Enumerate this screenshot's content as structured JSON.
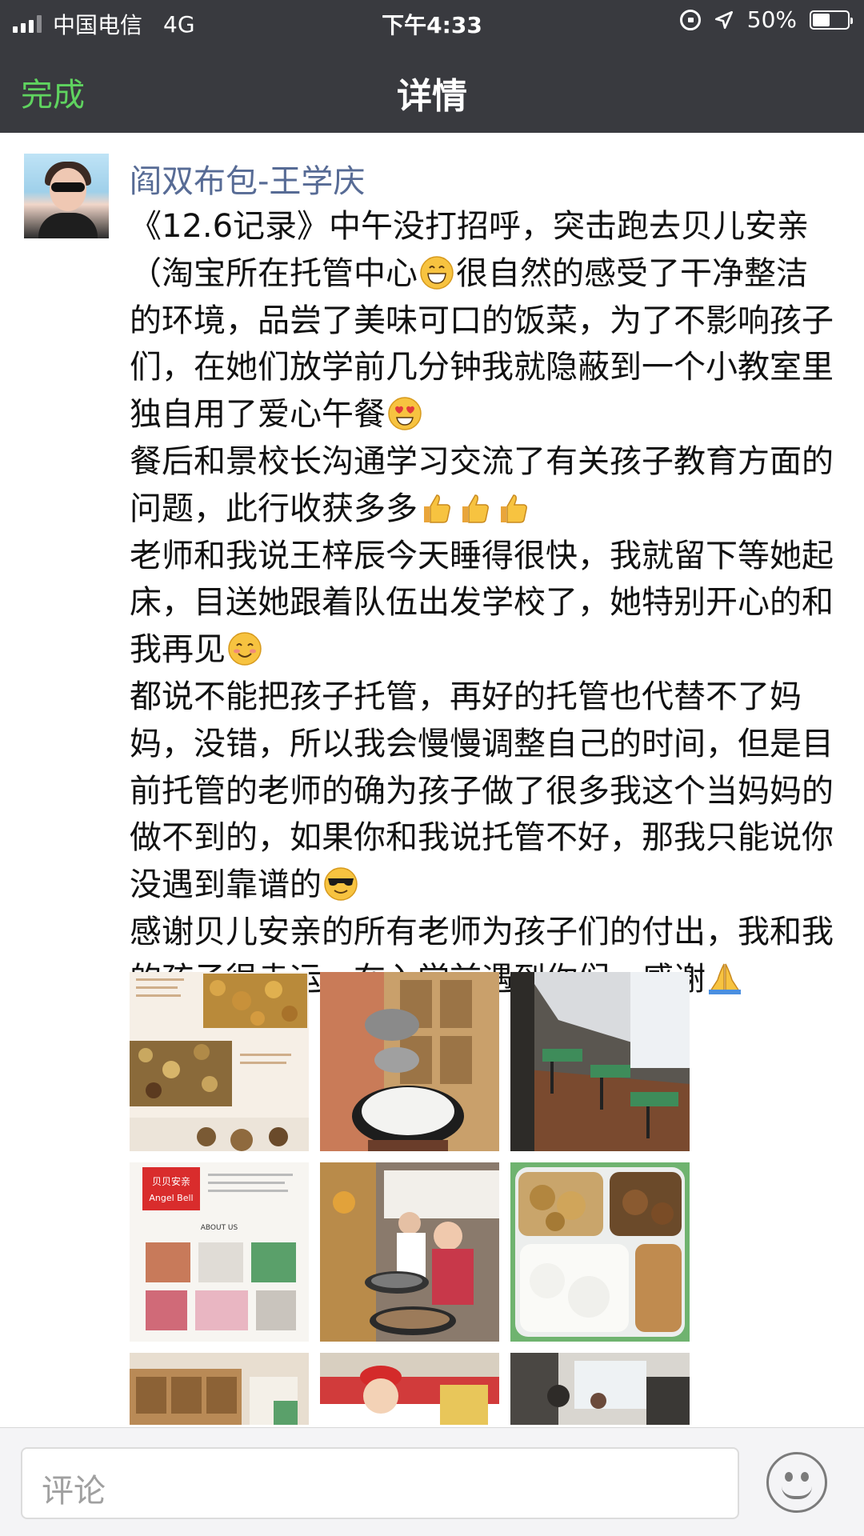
{
  "status_bar": {
    "carrier": "中国电信",
    "network": "4G",
    "time": "下午4:33",
    "battery": "50%",
    "battery_level": 0.5,
    "icons": [
      "signal-icon",
      "rotation-lock-icon",
      "location-arrow-icon",
      "battery-icon"
    ]
  },
  "navbar": {
    "done_label": "完成",
    "title": "详情",
    "accent_color": "#5fd35f"
  },
  "post": {
    "author": "阎双布包-王学庆",
    "paragraphs": [
      {
        "text": "《12.6记录》中午没打招呼，突击跑去贝儿安亲（淘宝所在托管中心",
        "emoji": "grinning-face-emoji",
        "text2": "很自然的感受了干净整洁的环境，品尝了美味可口的饭菜，为了不影响孩子们，在她们放学前几分钟我就隐蔽到一个小教室里独自用了爱心午餐",
        "emoji2": "heart-eyes-emoji"
      },
      {
        "text": "餐后和景校长沟通学习交流了有关孩子教育方面的问题，此行收获多多",
        "emoji": "thumbs-up-emoji-x3"
      },
      {
        "text": "老师和我说王梓辰今天睡得很快，我就留下等她起床，目送她跟着队伍出发学校了，她特别开心的和我再见",
        "emoji": "smiling-face-emoji"
      },
      {
        "text": "都说不能把孩子托管，再好的托管也代替不了妈妈，没错，所以我会慢慢调整自己的时间，但是目前托管的老师的确为孩子做了很多我这个当妈妈的做不到的，如果你和我说托管不好，那我只能说你没遇到靠谱的",
        "emoji": "sunglasses-emoji"
      },
      {
        "text": "感谢贝儿安亲的所有老师为孩子们的付出，我和我的孩子很幸运，在入学前遇到你们，感谢",
        "emoji": "folded-hands-emoji"
      }
    ],
    "photos": [
      {
        "name": "photo-food-flyer",
        "caption_lines": [
          "口感丰富",
          "美味又营养",
          "给孩子吃"
        ]
      },
      {
        "name": "photo-rice-pot"
      },
      {
        "name": "photo-classroom"
      },
      {
        "name": "photo-angel-bell-flyer",
        "brand_cn": "贝贝安亲",
        "brand_en": "Angel Bell",
        "heading": "ABOUT US"
      },
      {
        "name": "photo-lunch-line"
      },
      {
        "name": "photo-lunch-tray"
      },
      {
        "name": "photo-shelves"
      },
      {
        "name": "photo-child"
      },
      {
        "name": "photo-hall"
      }
    ]
  },
  "comment_bar": {
    "placeholder": "评论"
  }
}
